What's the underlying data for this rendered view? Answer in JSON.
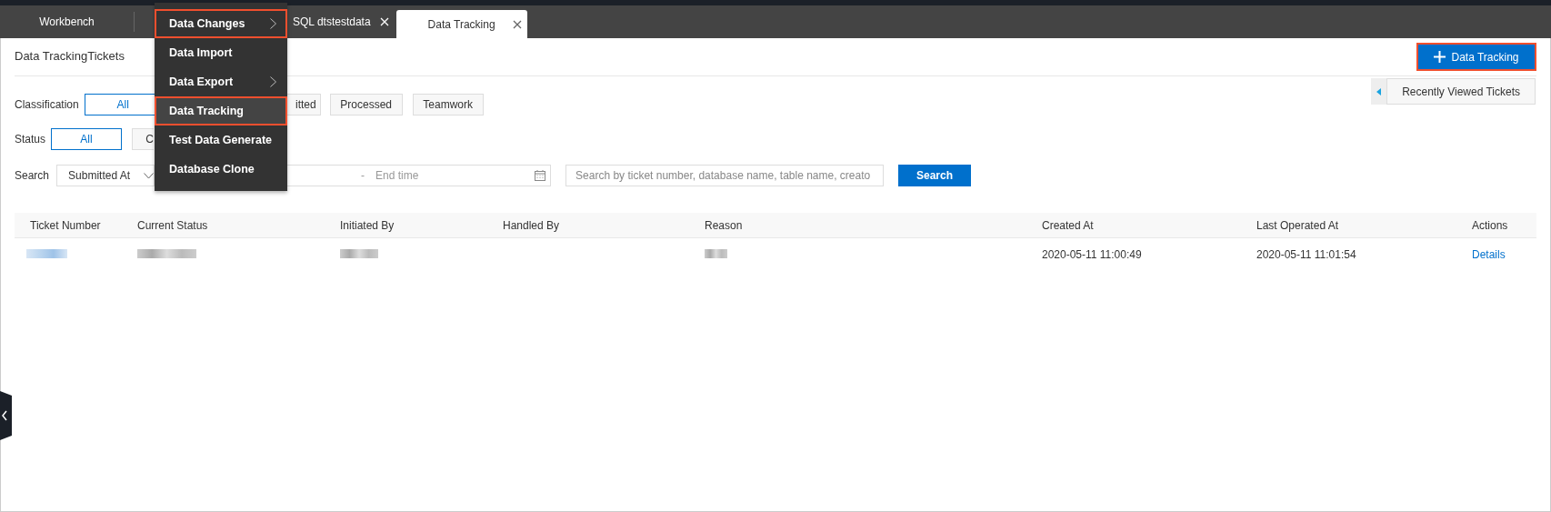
{
  "tabs": [
    {
      "label": "Workbench",
      "selected": false,
      "closable": false
    },
    {
      "label": "SQL dtstestdata",
      "selected": false,
      "closable": true
    },
    {
      "label": "Data Tracking",
      "selected": true,
      "closable": true
    }
  ],
  "menu": [
    {
      "label": "Data Changes",
      "selected": false,
      "highlighted": true,
      "submenu": true
    },
    {
      "label": "Data Import",
      "selected": false,
      "highlighted": false,
      "submenu": false
    },
    {
      "label": "Data Export",
      "selected": false,
      "highlighted": false,
      "submenu": true
    },
    {
      "label": "Data Tracking",
      "selected": true,
      "highlighted": true,
      "submenu": false
    },
    {
      "label": "Test Data Generate",
      "selected": false,
      "highlighted": false,
      "submenu": false
    },
    {
      "label": "Database Clone",
      "selected": false,
      "highlighted": false,
      "submenu": false
    }
  ],
  "page_title": "Data TrackingTickets",
  "new_button": {
    "label": "Data Tracking",
    "highlighted": true
  },
  "recent_tab": "Recently Viewed Tickets",
  "classification": {
    "label": "Classification",
    "options": [
      {
        "label": "All",
        "selected": true
      },
      {
        "label": "itted",
        "selected": false
      },
      {
        "label": "Processed",
        "selected": false
      },
      {
        "label": "Teamwork",
        "selected": false
      }
    ]
  },
  "status": {
    "label": "Status",
    "options": [
      {
        "label": "All",
        "selected": true
      },
      {
        "label": "C",
        "selected": false
      }
    ]
  },
  "search": {
    "label": "Search",
    "field": "Submitted At",
    "end_placeholder": "End time",
    "separator": "-",
    "placeholder": "Search by ticket number, database name, table name, creato",
    "button": "Search"
  },
  "table": {
    "columns": [
      "Ticket Number",
      "Current Status",
      "Initiated By",
      "Handled By",
      "Reason",
      "Created At",
      "Last Operated At",
      "Actions"
    ],
    "rows": [
      {
        "cells": [
          {
            "kind": "redacted_link"
          },
          {
            "kind": "redacted"
          },
          {
            "kind": "redacted"
          },
          {
            "kind": "empty"
          },
          {
            "kind": "redacted"
          },
          {
            "kind": "text",
            "text": "2020-05-11 11:00:49"
          },
          {
            "kind": "text",
            "text": "2020-05-11 11:01:54"
          },
          {
            "kind": "link",
            "text": "Details"
          }
        ]
      }
    ]
  }
}
